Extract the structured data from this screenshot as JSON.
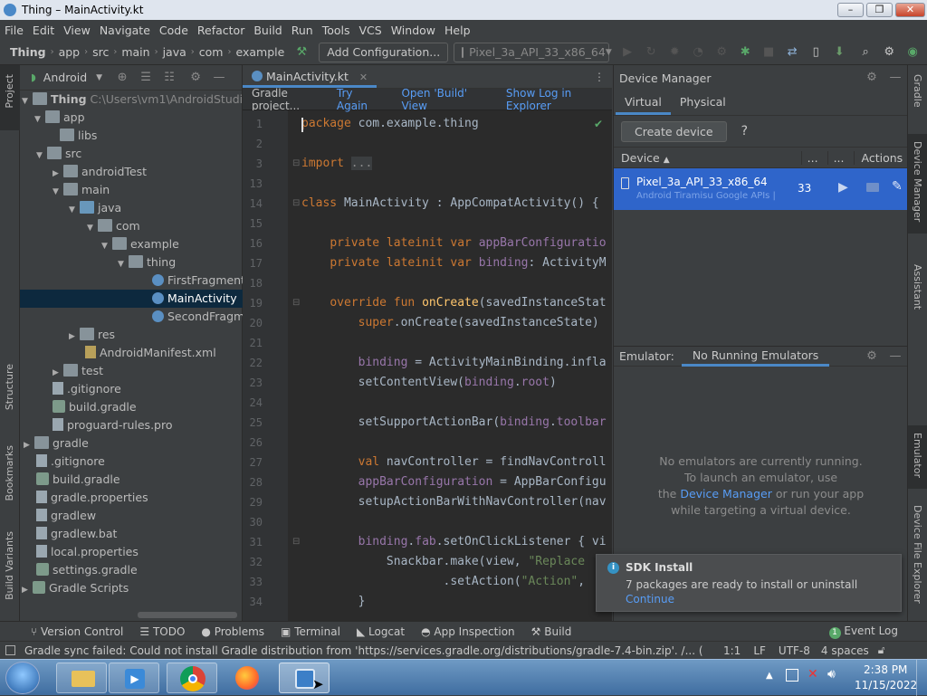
{
  "window": {
    "title": "Thing – MainActivity.kt"
  },
  "menu": [
    "File",
    "Edit",
    "View",
    "Navigate",
    "Code",
    "Refactor",
    "Build",
    "Run",
    "Tools",
    "VCS",
    "Window",
    "Help"
  ],
  "breadcrumb": [
    "Thing",
    "app",
    "src",
    "main",
    "java",
    "com",
    "example"
  ],
  "toolbar": {
    "config_label": "Add Configuration...",
    "device_label": "Pixel_3a_API_33_x86_64"
  },
  "left_stripe": {
    "project": "Project",
    "structure": "Structure",
    "bookmarks": "Bookmarks",
    "build_variants": "Build Variants"
  },
  "project": {
    "view_label": "Android",
    "tree": [
      {
        "label": "Thing",
        "extra": "C:\\Users\\vm1\\AndroidStudioProject"
      },
      {
        "label": "app"
      },
      {
        "label": "libs"
      },
      {
        "label": "src"
      },
      {
        "label": "androidTest"
      },
      {
        "label": "main"
      },
      {
        "label": "java"
      },
      {
        "label": "com"
      },
      {
        "label": "example"
      },
      {
        "label": "thing"
      },
      {
        "label": "FirstFragment"
      },
      {
        "label": "MainActivity"
      },
      {
        "label": "SecondFragmen"
      },
      {
        "label": "res"
      },
      {
        "label": "AndroidManifest.xml"
      },
      {
        "label": "test"
      },
      {
        "label": ".gitignore"
      },
      {
        "label": "build.gradle"
      },
      {
        "label": "proguard-rules.pro"
      },
      {
        "label": "gradle"
      },
      {
        "label": ".gitignore"
      },
      {
        "label": "build.gradle"
      },
      {
        "label": "gradle.properties"
      },
      {
        "label": "gradlew"
      },
      {
        "label": "gradlew.bat"
      },
      {
        "label": "local.properties"
      },
      {
        "label": "settings.gradle"
      },
      {
        "label": "Gradle Scripts"
      }
    ]
  },
  "editor": {
    "tab": "MainActivity.kt",
    "banner": {
      "text": "Gradle project...",
      "try_again": "Try Again",
      "open_build": "Open 'Build' View",
      "show_log": "Show Log in Explorer"
    },
    "lines": [
      "1",
      "2",
      "3",
      "13",
      "14",
      "15",
      "16",
      "17",
      "18",
      "19",
      "20",
      "21",
      "22",
      "23",
      "24",
      "25",
      "26",
      "27",
      "28",
      "29",
      "30",
      "31",
      "32",
      "33",
      "34"
    ]
  },
  "device_manager": {
    "title": "Device Manager",
    "tabs": [
      "Virtual",
      "Physical"
    ],
    "create_device": "Create device",
    "help": "?",
    "col_device": "Device",
    "col_actions": "Actions",
    "col_dots1": "...",
    "col_dots2": "...",
    "device_name": "Pixel_3a_API_33_x86_64",
    "device_sub": "Android Tiramisu Google APIs |",
    "device_api": "33"
  },
  "emulator": {
    "label": "Emulator:",
    "tab": "No Running Emulators",
    "msg1": "No emulators are currently running.",
    "msg2": "To launch an emulator, use",
    "msg3_pre": "the",
    "msg3_link": "Device Manager",
    "msg3_post": "or run your app",
    "msg4": "while targeting a virtual device."
  },
  "right_stripe": {
    "gradle": "Gradle",
    "device_manager": "Device Manager",
    "assistant": "Assistant",
    "emulator": "Emulator",
    "device_file_explorer": "Device File Explorer"
  },
  "notification": {
    "title": "SDK Install",
    "body": "7 packages are ready to install or uninstall",
    "link": "Continue"
  },
  "bottom_tools": [
    "Version Control",
    "TODO",
    "Problems",
    "Terminal",
    "Logcat",
    "App Inspection",
    "Build"
  ],
  "event_log": {
    "count": "1",
    "label": "Event Log"
  },
  "status": {
    "message": "Gradle sync failed: Could not install Gradle distribution from 'https://services.gradle.org/distributions/gradle-7.4-bin.zip'. /... (3 minutes ago)",
    "position": "1:1",
    "line_sep": "LF",
    "encoding": "UTF-8",
    "indent": "4 spaces"
  },
  "taskbar": {
    "time": "2:38 PM",
    "date": "11/15/2022"
  },
  "colors": {
    "accent": "#4a88c7",
    "selected_row": "#0d293e",
    "keyword": "#cc7832",
    "function": "#ffc66d",
    "string": "#6a8759",
    "property": "#9876aa"
  }
}
